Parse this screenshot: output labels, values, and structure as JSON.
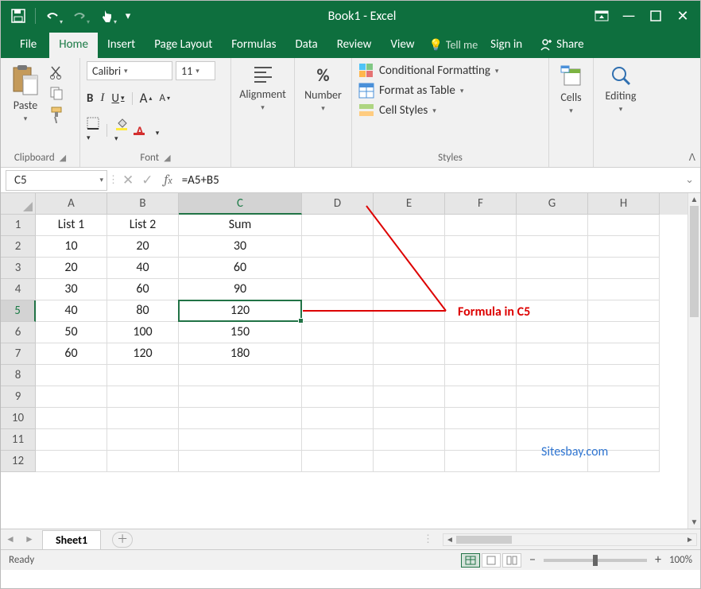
{
  "title": "Book1 - Excel",
  "tabs": {
    "file": "File",
    "home": "Home",
    "insert": "Insert",
    "page_layout": "Page Layout",
    "formulas": "Formulas",
    "data": "Data",
    "review": "Review",
    "view": "View"
  },
  "tellme": "Tell me",
  "signin": "Sign in",
  "share": "Share",
  "clipboard": {
    "paste": "Paste",
    "label": "Clipboard"
  },
  "font": {
    "name": "Calibri",
    "size": "11",
    "label": "Font",
    "bold": "B",
    "italic": "I",
    "underline": "U",
    "grow": "A",
    "shrink": "A"
  },
  "alignment": {
    "label": "Alignment"
  },
  "number": {
    "label": "Number"
  },
  "styles": {
    "cond": "Conditional Formatting",
    "table": "Format as Table",
    "cell": "Cell Styles",
    "label": "Styles"
  },
  "cells_grp": {
    "label": "Cells"
  },
  "editing": {
    "label": "Editing"
  },
  "namebox": "C5",
  "formula": "=A5+B5",
  "columns": [
    "A",
    "B",
    "C",
    "D",
    "E",
    "F",
    "G",
    "H"
  ],
  "rows": [
    "1",
    "2",
    "3",
    "4",
    "5",
    "6",
    "7",
    "8",
    "9",
    "10",
    "11",
    "12"
  ],
  "chart_data": {
    "type": "table",
    "headers": [
      "List 1",
      "List 2",
      "Sum"
    ],
    "data": [
      [
        10,
        20,
        30
      ],
      [
        20,
        40,
        60
      ],
      [
        30,
        60,
        90
      ],
      [
        40,
        80,
        120
      ],
      [
        50,
        100,
        150
      ],
      [
        60,
        120,
        180
      ]
    ]
  },
  "selected_cell": "C5",
  "annotation": "Formula in C5",
  "watermark": "Sitesbay.com",
  "sheet_tab": "Sheet1",
  "status": "Ready",
  "zoom": "100%"
}
